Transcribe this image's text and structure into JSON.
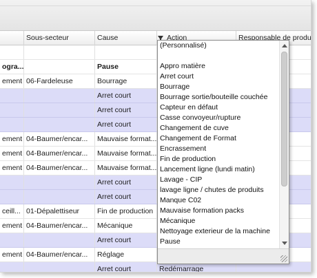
{
  "grid": {
    "columns": [
      "",
      "Sous-secteur",
      "Cause",
      "Action",
      "Responsable de production"
    ],
    "rows": [
      {
        "kind": "plain",
        "cells": [
          "",
          "",
          "",
          "",
          ""
        ]
      },
      {
        "kind": "group",
        "cells": [
          "ogra...",
          "",
          "Pause",
          "",
          ""
        ]
      },
      {
        "kind": "plain",
        "cells": [
          "ement",
          "06-Fardeleuse",
          "Bourrage",
          "",
          ""
        ]
      },
      {
        "kind": "lav",
        "cells": [
          "",
          "",
          "Arret court",
          "",
          ""
        ]
      },
      {
        "kind": "lav",
        "cells": [
          "",
          "",
          "Arret court",
          "",
          ""
        ]
      },
      {
        "kind": "lav",
        "cells": [
          "",
          "",
          "Arret court",
          "",
          ""
        ]
      },
      {
        "kind": "plain",
        "cells": [
          "ement",
          "04-Baumer/encar...",
          "Mauvaise format...",
          "",
          ""
        ]
      },
      {
        "kind": "plain",
        "cells": [
          "ement",
          "04-Baumer/encar...",
          "Mauvaise format...",
          "",
          ""
        ]
      },
      {
        "kind": "plain",
        "cells": [
          "ement",
          "04-Baumer/encar...",
          "Mauvaise format...",
          "",
          ""
        ]
      },
      {
        "kind": "lav",
        "cells": [
          "",
          "",
          "Arret court",
          "",
          ""
        ]
      },
      {
        "kind": "lav",
        "cells": [
          "",
          "",
          "Arret court",
          "",
          ""
        ]
      },
      {
        "kind": "plain",
        "cells": [
          "ceill...",
          "01-Dépalettiseur",
          "Fin de production",
          "",
          ""
        ]
      },
      {
        "kind": "plain",
        "cells": [
          "ement",
          "04-Baumer/encar...",
          "Mécanique",
          "",
          ""
        ]
      },
      {
        "kind": "lav",
        "cells": [
          "",
          "",
          "Arret court",
          "",
          ""
        ]
      },
      {
        "kind": "plain",
        "cells": [
          "ement",
          "04-Baumer/encar...",
          "Réglage",
          "",
          ""
        ]
      },
      {
        "kind": "lav",
        "cells": [
          "",
          "",
          "Arret court",
          "Redémarrage",
          ""
        ]
      }
    ]
  },
  "dropdown": {
    "items": [
      "(Personnalisé)",
      "",
      "Appro matière",
      "Arret court",
      "Bourrage",
      "Bourrage sortie/bouteille couchée",
      "Capteur en défaut",
      "Casse convoyeur/rupture",
      "Changement de cuve",
      "Changement de Format",
      "Encrassement",
      "Fin de production",
      "Lancement ligne (lundi matin)",
      "Lavage - CIP",
      "lavage ligne / chutes de produits",
      "Manque C02",
      "Mauvaise formation packs",
      "Mécanique",
      "Nettoyage exterieur de la machine",
      "Pause"
    ]
  },
  "icons": {
    "filter": "filter-icon",
    "scroll_up": "chevron-up-icon",
    "scroll_down": "chevron-down-icon",
    "resize": "resize-grip-icon"
  },
  "colors": {
    "highlight_row": "#dcdcf8",
    "header_bg": "#ededed"
  }
}
